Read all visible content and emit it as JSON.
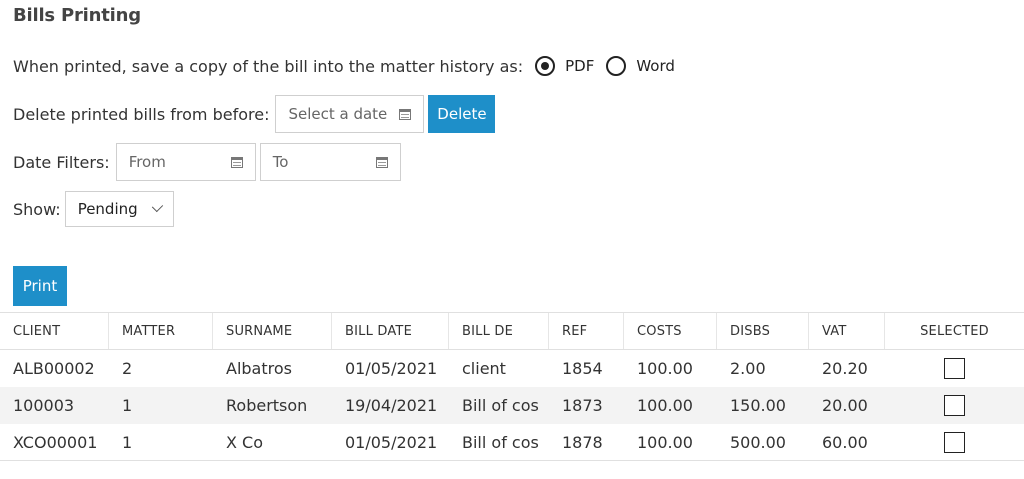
{
  "title": "Bills Printing",
  "save_copy": {
    "label": "When printed, save a copy of the bill into the matter history as:",
    "options": [
      {
        "label": "PDF",
        "checked": true
      },
      {
        "label": "Word",
        "checked": false
      }
    ]
  },
  "delete_section": {
    "label": "Delete printed bills from before:",
    "date_placeholder": "Select a date",
    "button_label": "Delete"
  },
  "date_filters": {
    "label": "Date Filters:",
    "from_placeholder": "From",
    "to_placeholder": "To"
  },
  "show": {
    "label": "Show:",
    "selected": "Pending"
  },
  "print_button": "Print",
  "table": {
    "headers": [
      "CLIENT",
      "MATTER",
      "SURNAME",
      "BILL DATE",
      "BILL DE",
      "REF",
      "COSTS",
      "DISBS",
      "VAT",
      "SELECTED"
    ],
    "rows": [
      {
        "client": "ALB00002",
        "matter": "2",
        "surname": "Albatros",
        "bill_date": "01/05/2021",
        "bill_desc": "client",
        "ref": "1854",
        "costs": "100.00",
        "disbs": "2.00",
        "vat": "20.20",
        "selected": false
      },
      {
        "client": "100003",
        "matter": "1",
        "surname": "Robertson",
        "bill_date": "19/04/2021",
        "bill_desc": "Bill of cos",
        "ref": "1873",
        "costs": "100.00",
        "disbs": "150.00",
        "vat": "20.00",
        "selected": false
      },
      {
        "client": "XCO00001",
        "matter": "1",
        "surname": "X Co",
        "bill_date": "01/05/2021",
        "bill_desc": "Bill of cos",
        "ref": "1878",
        "costs": "100.00",
        "disbs": "500.00",
        "vat": "60.00",
        "selected": false
      }
    ]
  },
  "icons": {
    "calendar": "calendar-icon",
    "dropdown": "chevron-down-icon"
  },
  "colors": {
    "accent": "#1e8fc9",
    "alt_row": "#f3f3f3"
  }
}
